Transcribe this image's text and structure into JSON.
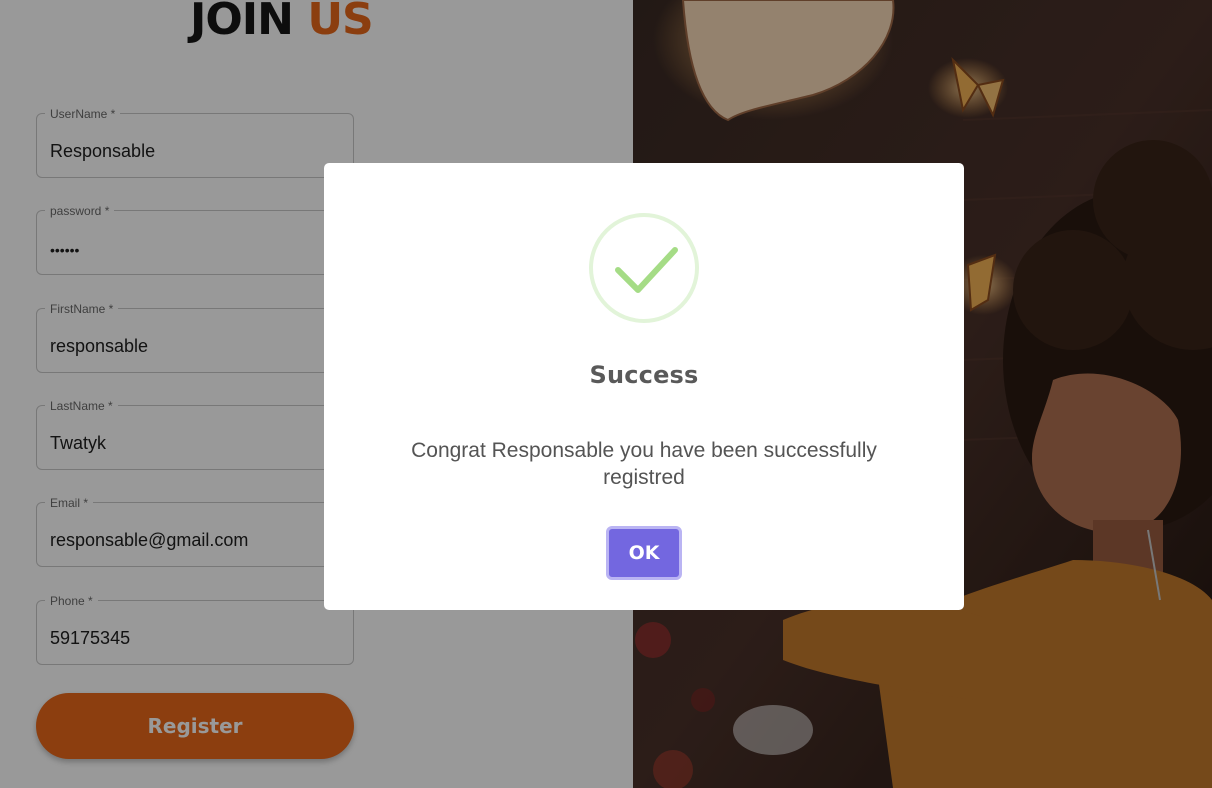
{
  "page": {
    "title_part1": "JOIN",
    "title_part2": "US",
    "accent_color": "#e8681a"
  },
  "form": {
    "fields": [
      {
        "label": "UserName *",
        "value": "Responsable"
      },
      {
        "label": "password *",
        "value": "••••••"
      },
      {
        "label": "FirstName *",
        "value": "responsable"
      },
      {
        "label": "LastName *",
        "value": "Twatyk"
      },
      {
        "label": "Email *",
        "value": "responsable@gmail.com"
      },
      {
        "label": "Phone *",
        "value": "59175345"
      }
    ],
    "register_label": "Register"
  },
  "modal": {
    "icon": "success-check-icon",
    "title": "Success",
    "message": "Congrat Responsable you have been successfully registred",
    "ok_label": "OK",
    "ok_color": "#7367e0",
    "check_color": "#a5dc86"
  }
}
